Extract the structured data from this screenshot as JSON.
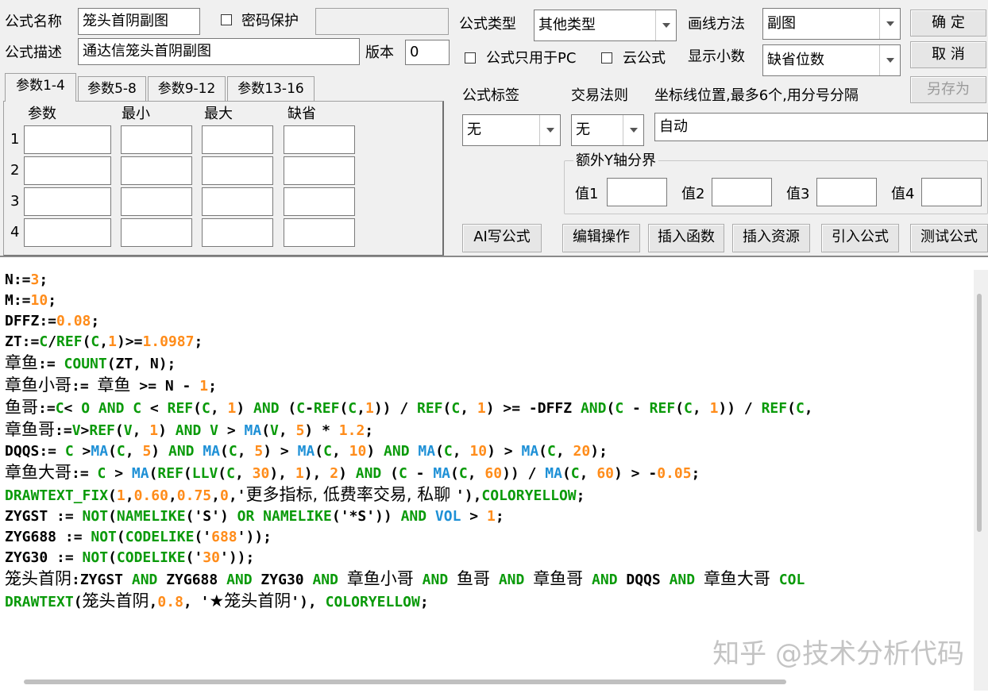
{
  "header": {
    "formula_name_label": "公式名称",
    "formula_name_value": "笼头首阴副图",
    "password_label": "密码保护",
    "formula_desc_label": "公式描述",
    "formula_desc_value": "通达信笼头首阴副图",
    "version_label": "版本",
    "version_value": "0",
    "formula_type_label": "公式类型",
    "formula_type_value": "其他类型",
    "draw_method_label": "画线方法",
    "draw_method_value": "副图",
    "pc_only_label": "公式只用于PC",
    "cloud_label": "云公式",
    "decimal_label": "显示小数",
    "decimal_value": "缺省位数"
  },
  "buttons": {
    "ok": "确 定",
    "cancel": "取 消",
    "save_as": "另存为",
    "ai_write": "AI写公式",
    "edit_ops": "编辑操作",
    "insert_func": "插入函数",
    "insert_res": "插入资源",
    "import_formula": "引入公式",
    "test_formula": "测试公式"
  },
  "tabs": [
    "参数1-4",
    "参数5-8",
    "参数9-12",
    "参数13-16"
  ],
  "params": {
    "col_headers": [
      "参数",
      "最小",
      "最大",
      "缺省"
    ],
    "rows": [
      "1",
      "2",
      "3",
      "4"
    ]
  },
  "right_panel": {
    "tag_label": "公式标签",
    "tag_value": "无",
    "rule_label": "交易法则",
    "rule_value": "无",
    "coord_label": "坐标线位置,最多6个,用分号分隔",
    "coord_value": "自动",
    "extra_y_label": "额外Y轴分界",
    "v1": "值1",
    "v2": "值2",
    "v3": "值3",
    "v4": "值4"
  },
  "code_lines": [
    "N:=3;",
    "M:=10;",
    "DFFZ:=0.08;",
    "ZT:=C/REF(C,1)>=1.0987;",
    "章鱼:= COUNT(ZT, N);",
    "章鱼小哥:= 章鱼 >= N - 1;",
    "鱼哥:=C< O AND C < REF(C, 1) AND (C-REF(C,1)) / REF(C, 1) >= -DFFZ AND(C - REF(C, 1)) / REF(C,",
    "章鱼哥:=V>REF(V, 1) AND V > MA(V, 5) * 1.2;",
    "DQQS:= C >MA(C, 5) AND MA(C, 5) > MA(C, 10) AND MA(C, 10) > MA(C, 20);",
    "章鱼大哥:= C > MA(REF(LLV(C, 30), 1), 2) AND (C - MA(C, 60)) / MA(C, 60) > -0.05;",
    "DRAWTEXT_FIX(1,0.60,0.75,0,'更多指标, 低费率交易, 私聊 '),COLORYELLOW;",
    "ZYGST := NOT(NAMELIKE('S') OR NAMELIKE('*S')) AND VOL > 1;",
    "ZYG688 := NOT(CODELIKE('688'));",
    "ZYG30 := NOT(CODELIKE('30'));",
    "笼头首阴:ZYGST AND ZYG688 AND ZYG30 AND 章鱼小哥 AND 鱼哥 AND 章鱼哥 AND DQQS AND 章鱼大哥 COL",
    "DRAWTEXT(笼头首阴,0.8, '★笼头首阴'), COLORYELLOW;"
  ],
  "watermark": "知乎 @技术分析代码"
}
